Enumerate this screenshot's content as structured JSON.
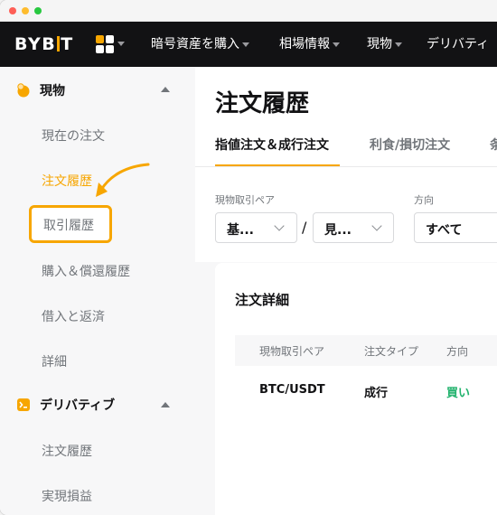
{
  "brand": {
    "logo_prefix": "BYB",
    "logo_suffix": "T",
    "accent": "#f7a600"
  },
  "nav": {
    "items": [
      {
        "label": "暗号資産を購入"
      },
      {
        "label": "相場情報"
      },
      {
        "label": "現物"
      },
      {
        "label": "デリバティ"
      }
    ]
  },
  "sidebar": {
    "spot": {
      "label": "現物",
      "items": [
        "現在の注文",
        "注文履歴",
        "取引履歴",
        "購入＆償還履歴",
        "借入と返済",
        "詳細"
      ]
    },
    "derivatives": {
      "label": "デリバティブ",
      "items": [
        "注文履歴",
        "実現損益"
      ]
    }
  },
  "main": {
    "title": "注文履歴",
    "tabs": [
      "指値注文＆成行注文",
      "利食/損切注文",
      "条"
    ],
    "filters": {
      "pair_label": "現物取引ペア",
      "base_value": "基...",
      "quote_value": "見...",
      "side_label": "方向",
      "side_value": "すべて"
    },
    "card": {
      "title": "注文詳細",
      "columns": [
        "現物取引ペア",
        "注文タイプ",
        "方向"
      ],
      "rows": [
        {
          "pair": "BTC/USDT",
          "type": "成行",
          "side": "買い"
        }
      ]
    }
  },
  "colors": {
    "buy": "#20b26c",
    "nav_bg": "#121214",
    "sidebar_bg": "#f7f7f8",
    "text_secondary": "#71757a"
  }
}
